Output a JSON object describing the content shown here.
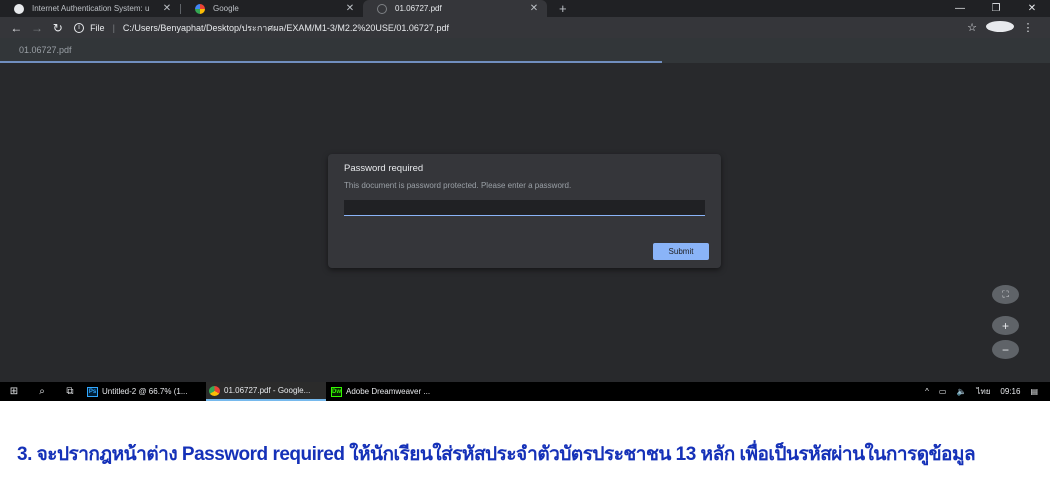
{
  "browser": {
    "tabs": [
      {
        "title": "Internet Authentication System: u",
        "favicon": "globe-icon",
        "active": false
      },
      {
        "title": "Google",
        "favicon": "google-icon",
        "active": false
      },
      {
        "title": "01.06727.pdf",
        "favicon": "pdf-loading-icon",
        "active": true
      }
    ],
    "new_tab_glyph": "+",
    "address": {
      "scheme_label": "File",
      "url": "C:/Users/Benyaphat/Desktop/ประกาศผล/EXAM/M1-3/M2.2%20USE/01.06727.pdf"
    }
  },
  "pdf_viewer": {
    "file_title": "01.06727.pdf",
    "dialog": {
      "title": "Password required",
      "message": "This document is password protected. Please enter a password.",
      "password_value": "",
      "submit_label": "Submit"
    },
    "zoom_controls": {
      "fit": "⛶",
      "zoom_in": "+",
      "zoom_out": "−"
    }
  },
  "taskbar": {
    "apps": [
      {
        "label": "Untitled-2 @ 66.7% (1...",
        "icon": "Ps",
        "color": "#31a8ff",
        "active": false
      },
      {
        "label": "01.06727.pdf - Google...",
        "icon": "chrome",
        "color": "#ea4335",
        "active": true
      },
      {
        "label": "Adobe Dreamweaver ...",
        "icon": "Dw",
        "color": "#35fa00",
        "active": false
      }
    ],
    "tray": {
      "language": "ไทย",
      "time": "09:16"
    }
  },
  "caption": {
    "text": "3. จะปรากฎหน้าต่าง Password required ให้นักเรียนใส่รหัสประจำตัวบัตรประชาชน 13 หลัก เพื่อเป็นรหัสผ่านในการดูข้อมูล"
  },
  "colors": {
    "accent": "#8ab4f8",
    "caption": "#1531b8",
    "viewer_bg": "#28292c"
  }
}
